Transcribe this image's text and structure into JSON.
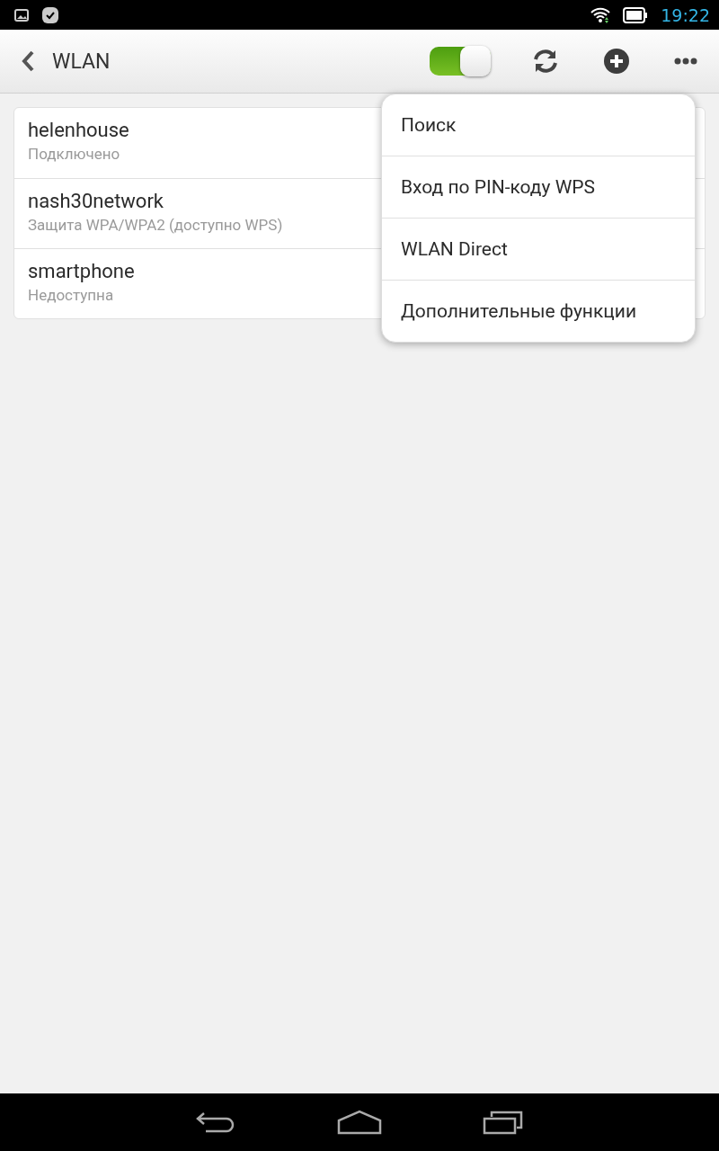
{
  "status_bar": {
    "time": "19:22"
  },
  "toolbar": {
    "title": "WLAN",
    "wlan_switch": {
      "on": true
    }
  },
  "networks": [
    {
      "name": "helenhouse",
      "status": "Подключено"
    },
    {
      "name": "nash30network",
      "status": "Защита WPA/WPA2 (доступно WPS)"
    },
    {
      "name": "smartphone",
      "status": "Недоступна"
    }
  ],
  "menu": {
    "items": [
      "Поиск",
      "Вход по PIN-коду WPS",
      "WLAN Direct",
      "Дополнительные функции"
    ]
  }
}
